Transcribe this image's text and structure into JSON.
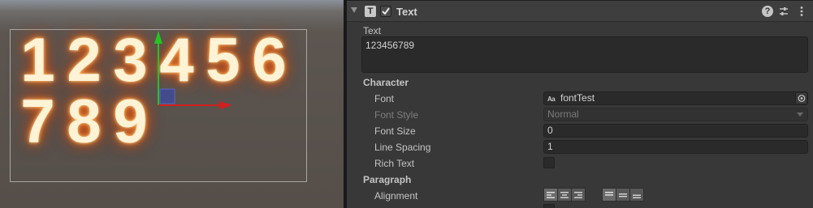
{
  "scene": {
    "digits_row1": [
      "1",
      "2",
      "3",
      "4",
      "5",
      "6"
    ],
    "digits_row2": [
      "7",
      "8",
      "9"
    ],
    "glow_color": "#ff9b3a",
    "gizmo": {
      "y_axis_color": "#22c61f",
      "x_axis_color": "#d21f1f",
      "plane_handle_color": "#3d4aa0"
    }
  },
  "component": {
    "title": "Text",
    "icon_glyph": "T",
    "enabled": true,
    "icons": {
      "type": "text-component-icon",
      "help": "help-icon",
      "presets": "presets-icon",
      "menu": "kebab-menu-icon"
    }
  },
  "text_section": {
    "label": "Text",
    "value": "123456789"
  },
  "character": {
    "header": "Character",
    "font_label": "Font",
    "font_icon_text": "Aa",
    "font_value": "fontTest",
    "font_style_label": "Font Style",
    "font_style_value": "Normal",
    "font_size_label": "Font Size",
    "font_size_value": "0",
    "line_spacing_label": "Line Spacing",
    "line_spacing_value": "1",
    "rich_text_label": "Rich Text",
    "rich_text_checked": false
  },
  "paragraph": {
    "header": "Paragraph",
    "alignment_label": "Alignment",
    "horizontal_options": [
      "align-left",
      "align-center",
      "align-right"
    ],
    "vertical_options": [
      "align-top",
      "align-middle",
      "align-bottom"
    ]
  },
  "colors": {
    "accent_text": "#c4c4c4",
    "panel_bg": "#383838",
    "field_bg": "#2a2a2a"
  }
}
